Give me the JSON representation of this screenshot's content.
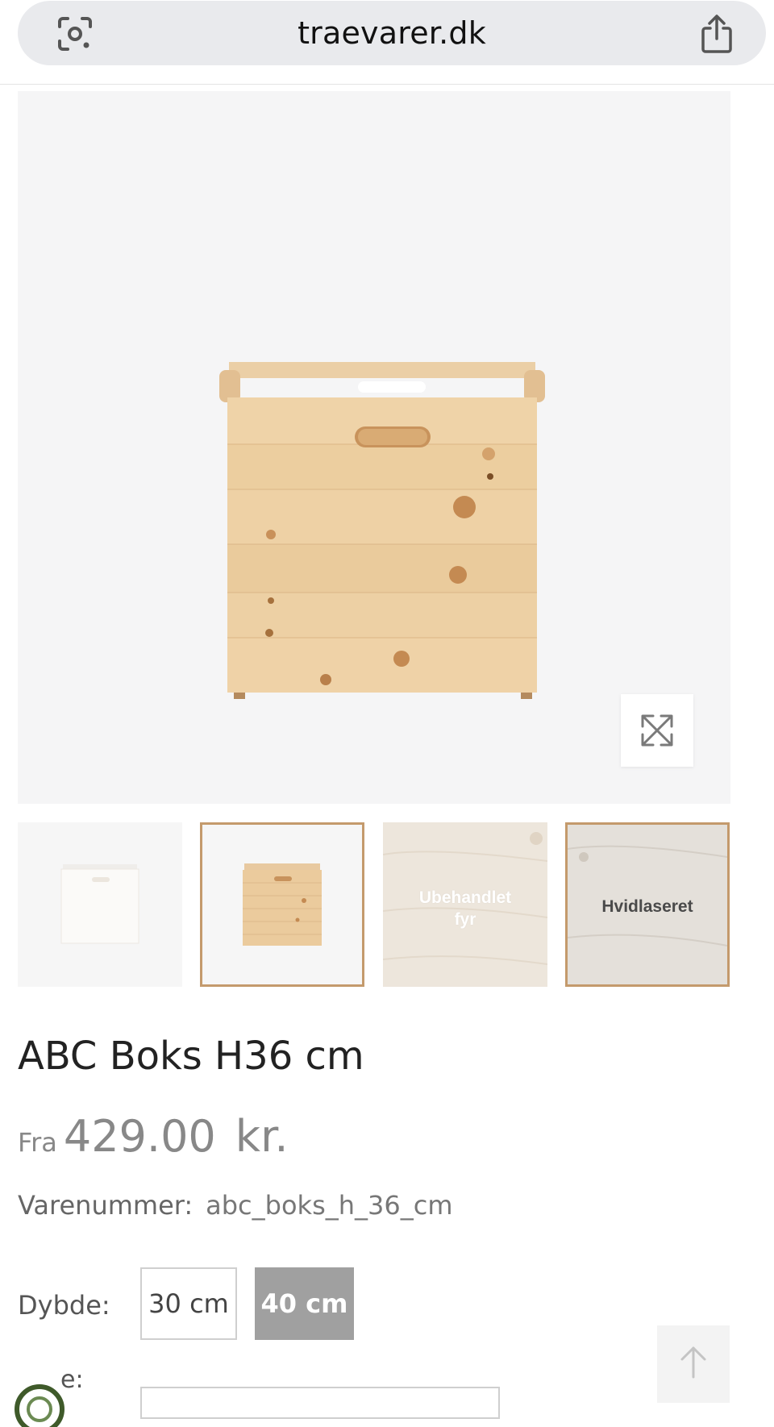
{
  "browser": {
    "url": "traevarer.dk",
    "icons": [
      "google-lens-icon",
      "share-icon"
    ]
  },
  "gallery": {
    "zoom_icon": "expand-arrows-icon",
    "thumbnails": [
      {
        "label": "",
        "kind": "white-box-image"
      },
      {
        "label": "",
        "kind": "pine-box-image",
        "selected": true
      },
      {
        "label": "Ubehandlet\nfyr",
        "kind": "swatch"
      },
      {
        "label": "Hvidlaseret",
        "kind": "swatch",
        "selected": true
      }
    ]
  },
  "product": {
    "title": "ABC Boks H36 cm",
    "price_prefix": "Fra",
    "price": "429.00",
    "currency": "kr.",
    "sku_label": "Varenummer:",
    "sku_value": "abc_boks_h_36_cm"
  },
  "options": {
    "depth_label": "Dybde:",
    "depth_values": [
      "30 cm",
      "40 cm"
    ],
    "selected_depth": "40 cm",
    "next_label_partial": "e:"
  },
  "colors": {
    "accent_border": "#c49a6c",
    "selected_option_bg": "#a0a0a0",
    "price_gray": "#888888"
  },
  "scroll_top_icon": "arrow-up-icon"
}
